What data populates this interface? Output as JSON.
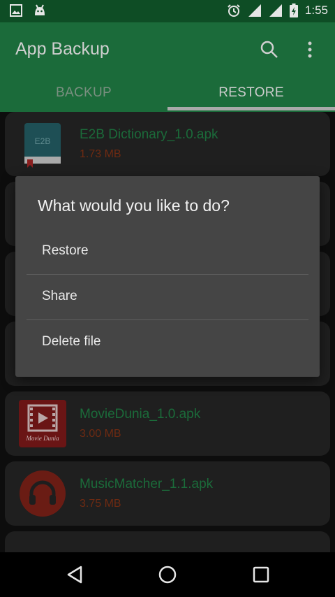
{
  "status_bar": {
    "time": "1:55"
  },
  "app_bar": {
    "title": "App Backup"
  },
  "tabs": [
    {
      "label": "BACKUP",
      "selected": false
    },
    {
      "label": "RESTORE",
      "selected": true
    }
  ],
  "files": [
    {
      "name": "E2B Dictionary_1.0.apk",
      "size": "1.73 MB",
      "icon": "dictionary-book-icon",
      "icon_text": "E2B"
    },
    {
      "name": "MovieDunia_1.0.apk",
      "size": "3.00 MB",
      "icon": "movie-play-icon",
      "icon_text": "Movie Dunia"
    },
    {
      "name": "MusicMatcher_1.1.apk",
      "size": "3.75 MB",
      "icon": "headphones-icon"
    }
  ],
  "dialog": {
    "title": "What would you like to do?",
    "options": [
      "Restore",
      "Share",
      "Delete file"
    ]
  },
  "colors": {
    "app_bar": "#1b6b3a",
    "status_bar": "#0e4d25",
    "file_name": "#1b6b3a",
    "file_size": "#6e2a12",
    "dialog_bg": "#454545"
  }
}
